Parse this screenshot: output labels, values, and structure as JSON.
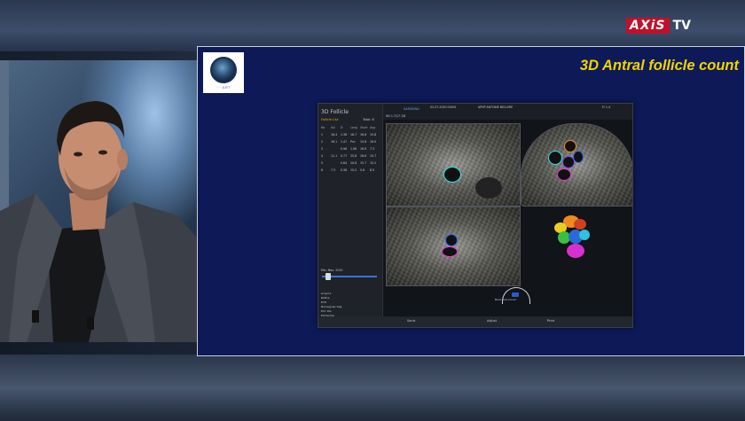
{
  "channel": {
    "logo_red": "AXiS",
    "logo_tv": "TV"
  },
  "slide": {
    "logo_brand": "··· ART",
    "title": "3D Antral follicle count"
  },
  "us_screen": {
    "app_title": "3D Follicle",
    "subtitle": "Follicle List",
    "total_label": "Total: 6",
    "header_left": "HD 1.7/17.7/8",
    "header_brand": "SAMSUNG",
    "header_date": "02-07-2020 00001",
    "header_hospital": "APHP ANTOINE BECLERE",
    "header_right": "Fr 1.4",
    "table_header": [
      "No",
      "Vol",
      "D",
      "Long",
      "Short",
      "Avg"
    ],
    "table_rows": [
      [
        "1",
        "16.4",
        "1.38",
        "16.7",
        "16.8",
        "15.8"
      ],
      [
        "2",
        "16.1",
        "1.47",
        "Pnc",
        "15.8",
        "16.0"
      ],
      [
        "3",
        "",
        "0.96",
        "1.98",
        "16.6",
        "7.3"
      ],
      [
        "4",
        "11.1",
        "0.77",
        "25.8",
        "16.6",
        "15.7"
      ],
      [
        "5",
        "",
        "0.64",
        "20.6",
        "15.7",
        "15.2"
      ],
      [
        "6",
        "7.3",
        "0.38",
        "15.5",
        "5.6",
        "8.5"
      ]
    ],
    "slider_label": "Min. Max. 2010",
    "legend": [
      "Acquire",
      "Refine",
      "Edit",
      "Nonregular Seg.",
      "Ext. Dis.",
      "Extraction"
    ],
    "footer_items": [
      "Sonic",
      "Adjust",
      "Print"
    ],
    "probe_label": "Back  Anti-Cover",
    "follicle_labels": [
      "1",
      "2",
      "3",
      "4",
      "5",
      "6"
    ]
  },
  "colors": {
    "slide_bg": "#0d1a57",
    "title": "#f0d400",
    "channel_red": "#c0102a",
    "seg_cyan": "#2fe6e6",
    "seg_orange": "#f08a20",
    "seg_blue": "#3a6cf0",
    "seg_magenta": "#e23ad8"
  }
}
